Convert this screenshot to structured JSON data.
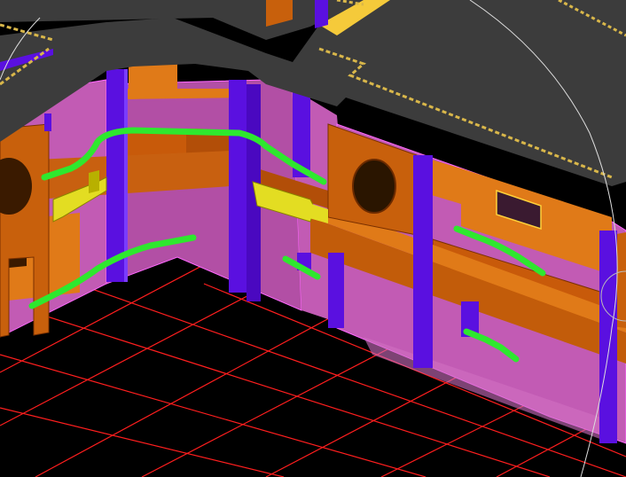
{
  "viewport": {
    "type": "3d-cad-viewport",
    "render_mode": "shaded",
    "background_color": "#000000"
  },
  "colors": {
    "ground_grid": "#ff1e1e",
    "slab_top": "#3c3c3c",
    "slab_edge_trim": "#d9b74a",
    "wall_magenta": "#c25bb4",
    "wall_magenta_dark": "#a8489b",
    "beam_orange": "#c8600c",
    "beam_orange_dark": "#9a4300",
    "beam_orange_light": "#e07a18",
    "column_violet": "#5a10e0",
    "column_violet_light": "#7a3cff",
    "highlight_green": "#2ee82e",
    "bracket_yellow": "#e3dd22",
    "view_cube_ring": "#dddddd"
  },
  "objects": {
    "floor_slab": "floor-slab",
    "curved_wall": "curved-wall",
    "columns": "columns",
    "beams": "beams",
    "brackets": "brackets",
    "highlighted_edges": "green-highlight-polylines",
    "grid": "ground-grid",
    "navigation_ring": "view-cube-ring"
  }
}
